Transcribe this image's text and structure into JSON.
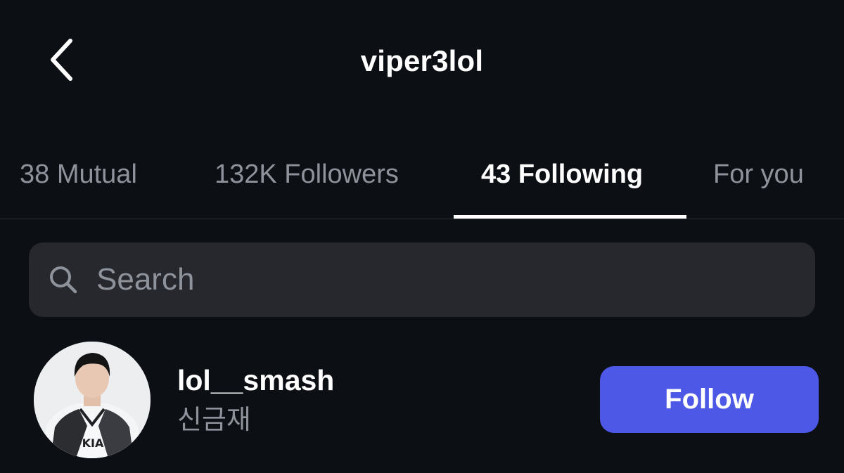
{
  "header": {
    "title": "viper3lol",
    "back_icon": "chevron-left-icon"
  },
  "tabs": [
    {
      "label": "38 Mutual",
      "active": false
    },
    {
      "label": "132K Followers",
      "active": false
    },
    {
      "label": "43 Following",
      "active": true
    },
    {
      "label": "For you",
      "active": false
    }
  ],
  "search": {
    "placeholder": "Search",
    "icon": "search-icon"
  },
  "list": {
    "items": [
      {
        "username": "lol__smash",
        "display_name": "신금재",
        "action_label": "Follow",
        "avatar": "avatar"
      }
    ]
  },
  "colors": {
    "background": "#0c0f14",
    "search_bg": "#26282e",
    "muted_text": "#8e929b",
    "accent": "#4e58e6"
  }
}
